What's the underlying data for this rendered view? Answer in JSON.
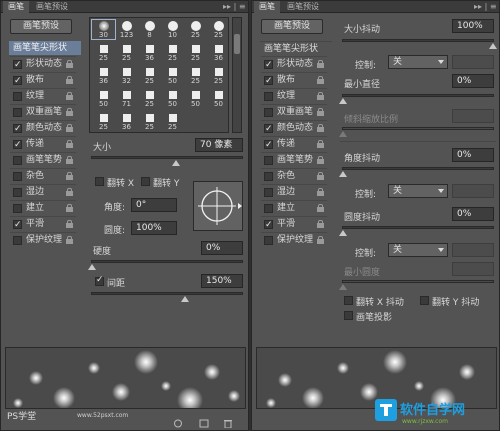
{
  "left_panel": {
    "tabs": [
      "画笔",
      "画笔预设"
    ],
    "tab_controls": "▸▸ | ≡",
    "preset_button": "画笔预设",
    "side_title": "画笔笔尖形状",
    "side_items": [
      {
        "label": "形状动态",
        "checked": true
      },
      {
        "label": "散布",
        "checked": true
      },
      {
        "label": "纹理",
        "checked": false
      },
      {
        "label": "双重画笔",
        "checked": false
      },
      {
        "label": "颜色动态",
        "checked": true
      },
      {
        "label": "传递",
        "checked": true
      },
      {
        "label": "画笔笔势",
        "checked": false
      },
      {
        "label": "杂色",
        "checked": false
      },
      {
        "label": "湿边",
        "checked": false
      },
      {
        "label": "建立",
        "checked": false
      },
      {
        "label": "平滑",
        "checked": true
      },
      {
        "label": "保护纹理",
        "checked": false
      }
    ],
    "brush_tips": [
      "30",
      "123",
      "8",
      "10",
      "25",
      "25",
      "25",
      "25",
      "36",
      "25",
      "25",
      "36",
      "36",
      "32",
      "25",
      "50",
      "25",
      "25",
      "50",
      "71",
      "25",
      "50",
      "50",
      "50",
      "25",
      "36",
      "25",
      "25"
    ],
    "size_label": "大小",
    "size_value": "70 像素",
    "flip_x": "翻转 X",
    "flip_y": "翻转 Y",
    "angle_label": "角度:",
    "angle_value": "0°",
    "roundness_label": "圆度:",
    "roundness_value": "100%",
    "hardness_label": "硬度",
    "hardness_value": "0%",
    "spacing_label": "间距",
    "spacing_checked": true,
    "spacing_value": "150%",
    "size_level": 0.56,
    "hardness_level": 0.0,
    "spacing_level": 0.62,
    "watermark_text": "PS学堂",
    "watermark_url": "www.52psxt.com"
  },
  "right_panel": {
    "tabs": [
      "画笔",
      "画笔预设"
    ],
    "tab_controls": "▸▸ | ≡",
    "preset_button": "画笔预设",
    "side_title": "画笔笔尖形状",
    "side_items": [
      {
        "label": "形状动态",
        "checked": true
      },
      {
        "label": "散布",
        "checked": true
      },
      {
        "label": "纹理",
        "checked": false
      },
      {
        "label": "双重画笔",
        "checked": false
      },
      {
        "label": "颜色动态",
        "checked": true
      },
      {
        "label": "传递",
        "checked": true
      },
      {
        "label": "画笔笔势",
        "checked": false
      },
      {
        "label": "杂色",
        "checked": false
      },
      {
        "label": "湿边",
        "checked": false
      },
      {
        "label": "建立",
        "checked": false
      },
      {
        "label": "平滑",
        "checked": true
      },
      {
        "label": "保护纹理",
        "checked": false
      }
    ],
    "size_jitter_label": "大小抖动",
    "size_jitter_value": "100%",
    "control_label": "控制:",
    "control_value": "关",
    "min_diameter_label": "最小直径",
    "min_diameter_value": "0%",
    "tilt_scale_label": "倾斜缩放比例",
    "angle_jitter_label": "角度抖动",
    "angle_jitter_value": "0%",
    "roundness_jitter_label": "圆度抖动",
    "roundness_jitter_value": "0%",
    "min_roundness_label": "最小圆度",
    "flip_x_jitter": "翻转 X 抖动",
    "flip_y_jitter": "翻转 Y 抖动",
    "brush_projection": "画笔投影",
    "logo_text": "软件自学网",
    "logo_url": "www.rjzxw.com",
    "size_jitter_level": 1.0,
    "min_diameter_level": 0.0,
    "angle_jitter_level": 0.0,
    "roundness_jitter_level": 0.0
  },
  "colors": {
    "panel_bg": "#535353",
    "highlight": "#6a7d99",
    "logo_blue": "#1e9fe0",
    "logo_green": "#7fbf3f"
  }
}
